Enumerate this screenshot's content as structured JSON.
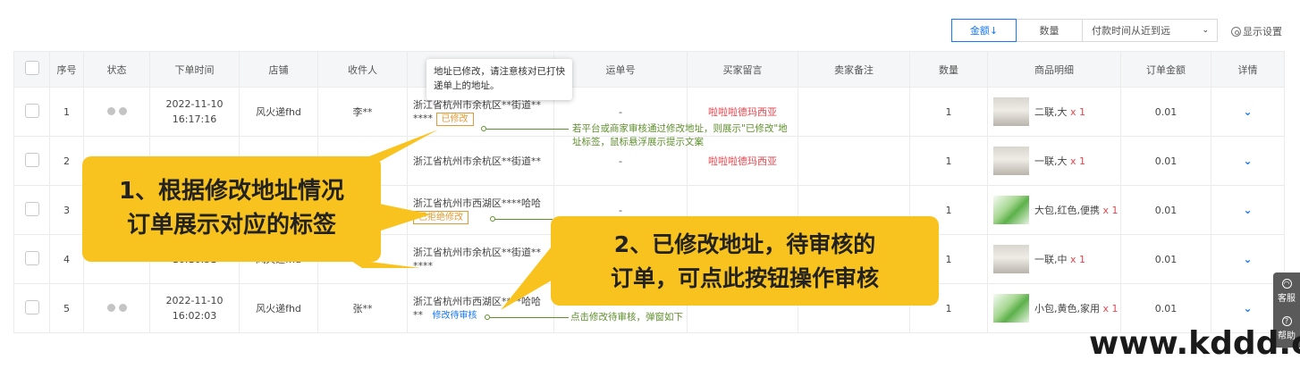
{
  "toolbar": {
    "sort_amount": "金额↓",
    "sort_qty": "数量",
    "sort_select": "付款时间从近到远",
    "display_settings": "显示设置"
  },
  "columns": [
    "",
    "序号",
    "状态",
    "下单时间",
    "店铺",
    "收件人",
    "地址",
    "运单号",
    "买家留言",
    "卖家备注",
    "数量",
    "商品明细",
    "订单金额",
    "详情"
  ],
  "tooltip": "地址已修改，请注意核对已打快递单上的地址。",
  "rows": [
    {
      "no": "1",
      "date": "2022-11-10",
      "time": "16:17:16",
      "shop": "风火递fhd",
      "receiver": "李**",
      "addr1": "浙江省杭州市余杭区**街道**",
      "addr2": "****",
      "tag": "已修改",
      "waybill": "-",
      "buyer_msg": "啦啦啦德玛西亚",
      "qty": "1",
      "goods": "二联,大",
      "goods_qty": "x 1",
      "amount": "0.01"
    },
    {
      "no": "2",
      "date": "2022-11-10",
      "time": "",
      "shop": "",
      "receiver": "",
      "addr1": "浙江省杭州市余杭区**街道**",
      "addr2": "",
      "tag": "",
      "waybill": "-",
      "buyer_msg": "啦啦啦德玛西亚",
      "qty": "1",
      "goods": "一联,大",
      "goods_qty": "x 1",
      "amount": "0.01"
    },
    {
      "no": "3",
      "date": "",
      "time": "",
      "shop": "",
      "receiver": "",
      "addr1": "浙江省杭州市西湖区****哈哈",
      "addr2": "",
      "tag": "已拒绝修改",
      "waybill": "-",
      "buyer_msg": "",
      "qty": "1",
      "goods": "大包,红色,便携",
      "goods_qty": "x 1",
      "amount": "0.01"
    },
    {
      "no": "4",
      "date": "",
      "time": "16:16:51",
      "shop": "风火递fhd",
      "receiver": "李**",
      "addr1": "浙江省杭州市余杭区**街道**",
      "addr2": "****",
      "tag": "",
      "waybill": "-",
      "buyer_msg": "",
      "qty": "1",
      "goods": "一联,中",
      "goods_qty": "x 1",
      "amount": "0.01"
    },
    {
      "no": "5",
      "date": "2022-11-10",
      "time": "16:02:03",
      "shop": "风火递fhd",
      "receiver": "张**",
      "addr1": "浙江省杭州市西湖区****哈哈",
      "addr2": "**",
      "tag": "修改待审核",
      "waybill": "",
      "buyer_msg": "",
      "qty": "1",
      "goods": "小包,黄色,家用",
      "goods_qty": "x 1",
      "amount": "0.01"
    }
  ],
  "annotations": {
    "note1": "若平台或商家审核通过修改地址，则展示\"已修改\"地址标签，鼠标悬浮展示提示文案",
    "note2": "点击修改待审核，弹窗如下",
    "callout1_line1": "1、根据修改地址情况",
    "callout1_line2": "订单展示对应的标签",
    "callout2_line1": "2、已修改地址，待审核的",
    "callout2_line2": "订单，可点此按钮操作审核"
  },
  "side": {
    "service": "客服",
    "help": "帮助"
  },
  "watermark": "www.kddd.cn",
  "colors": {
    "accent": "#1677ff",
    "tag_orange": "#e39a36",
    "callout": "#f9c31f",
    "annotation": "#5f8f2c",
    "red_text": "#e5464e"
  }
}
